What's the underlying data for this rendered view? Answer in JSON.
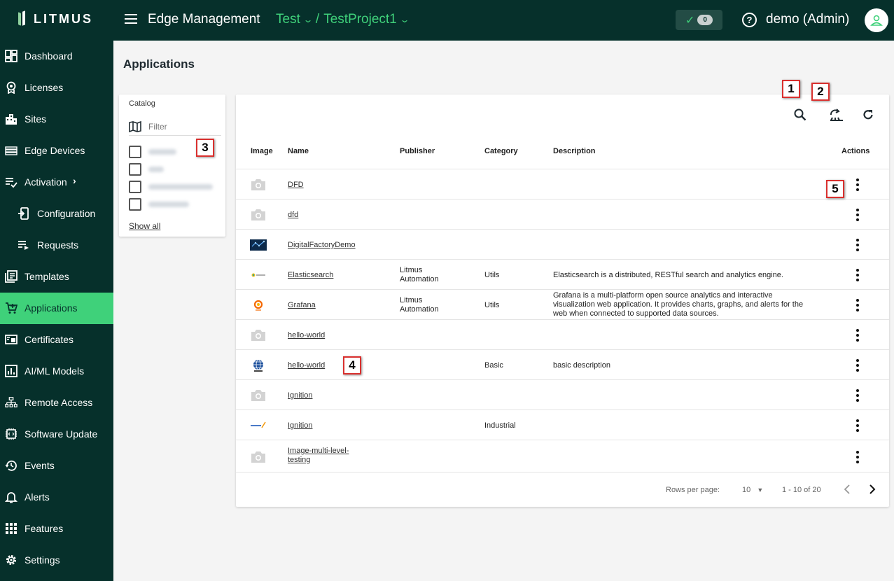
{
  "header": {
    "logo_text": "LITMUS",
    "title": "Edge Management",
    "crumb_company": "Test",
    "crumb_separator": "/",
    "crumb_project": "TestProject1",
    "status_count": "0",
    "user": "demo (Admin)"
  },
  "sidebar": {
    "items": [
      {
        "label": "Dashboard",
        "icon": "dashboard-icon"
      },
      {
        "label": "Licenses",
        "icon": "license-icon"
      },
      {
        "label": "Sites",
        "icon": "building-icon"
      },
      {
        "label": "Edge Devices",
        "icon": "server-icon"
      },
      {
        "label": "Activation",
        "icon": "playlist-check-icon"
      },
      {
        "label": "Configuration",
        "icon": "device-config-icon"
      },
      {
        "label": "Requests",
        "icon": "playlist-play-icon"
      },
      {
        "label": "Templates",
        "icon": "template-icon"
      },
      {
        "label": "Applications",
        "icon": "cart-icon"
      },
      {
        "label": "Certificates",
        "icon": "certificate-icon"
      },
      {
        "label": "AI/ML Models",
        "icon": "chart-box-icon"
      },
      {
        "label": "Remote Access",
        "icon": "network-icon"
      },
      {
        "label": "Software Update",
        "icon": "chip-icon"
      },
      {
        "label": "Events",
        "icon": "history-icon"
      },
      {
        "label": "Alerts",
        "icon": "bell-icon"
      },
      {
        "label": "Features",
        "icon": "grid-icon"
      },
      {
        "label": "Settings",
        "icon": "gear-icon"
      }
    ]
  },
  "page": {
    "title": "Applications"
  },
  "catalog": {
    "title": "Catalog",
    "filter_placeholder": "Filter",
    "show_all": "Show all"
  },
  "table": {
    "headers": {
      "image": "Image",
      "name": "Name",
      "publisher": "Publisher",
      "category": "Category",
      "description": "Description",
      "actions": "Actions"
    },
    "rows": [
      {
        "name": "DFD",
        "publisher": "",
        "category": "",
        "description": "",
        "image": "placeholder"
      },
      {
        "name": "dfd",
        "publisher": "",
        "category": "",
        "description": "",
        "image": "placeholder"
      },
      {
        "name": "DigitalFactoryDemo",
        "publisher": "",
        "category": "",
        "description": "",
        "image": "dfd-thumb"
      },
      {
        "name": "Elasticsearch",
        "publisher": "Litmus Automation",
        "category": "Utils",
        "description": "Elasticsearch is a distributed, RESTful search and analytics engine.",
        "image": "elastic-logo"
      },
      {
        "name": "Grafana",
        "publisher": "Litmus Automation",
        "category": "Utils",
        "description": "Grafana is a multi-platform open source analytics and interactive visualization web application. It provides charts, graphs, and alerts for the web when connected to supported data sources.",
        "image": "grafana-logo"
      },
      {
        "name": "hello-world",
        "publisher": "",
        "category": "",
        "description": "",
        "image": "placeholder"
      },
      {
        "name": "hello-world",
        "publisher": "",
        "category": "Basic",
        "description": "basic description",
        "image": "globe-logo"
      },
      {
        "name": "Ignition",
        "publisher": "",
        "category": "",
        "description": "",
        "image": "placeholder"
      },
      {
        "name": "Ignition",
        "publisher": "",
        "category": "Industrial",
        "description": "",
        "image": "ignition-logo"
      },
      {
        "name": "Image-multi-level-testing",
        "publisher": "",
        "category": "",
        "description": "",
        "image": "placeholder"
      }
    ]
  },
  "pagination": {
    "rows_per_page_label": "Rows per page:",
    "rows_per_page": "10",
    "range": "1 - 10 of 20"
  },
  "callouts": [
    "1",
    "2",
    "3",
    "4",
    "5"
  ],
  "colors": {
    "dark": "#06302b",
    "accent": "#3fd17a",
    "callout_border": "#d9302e"
  }
}
